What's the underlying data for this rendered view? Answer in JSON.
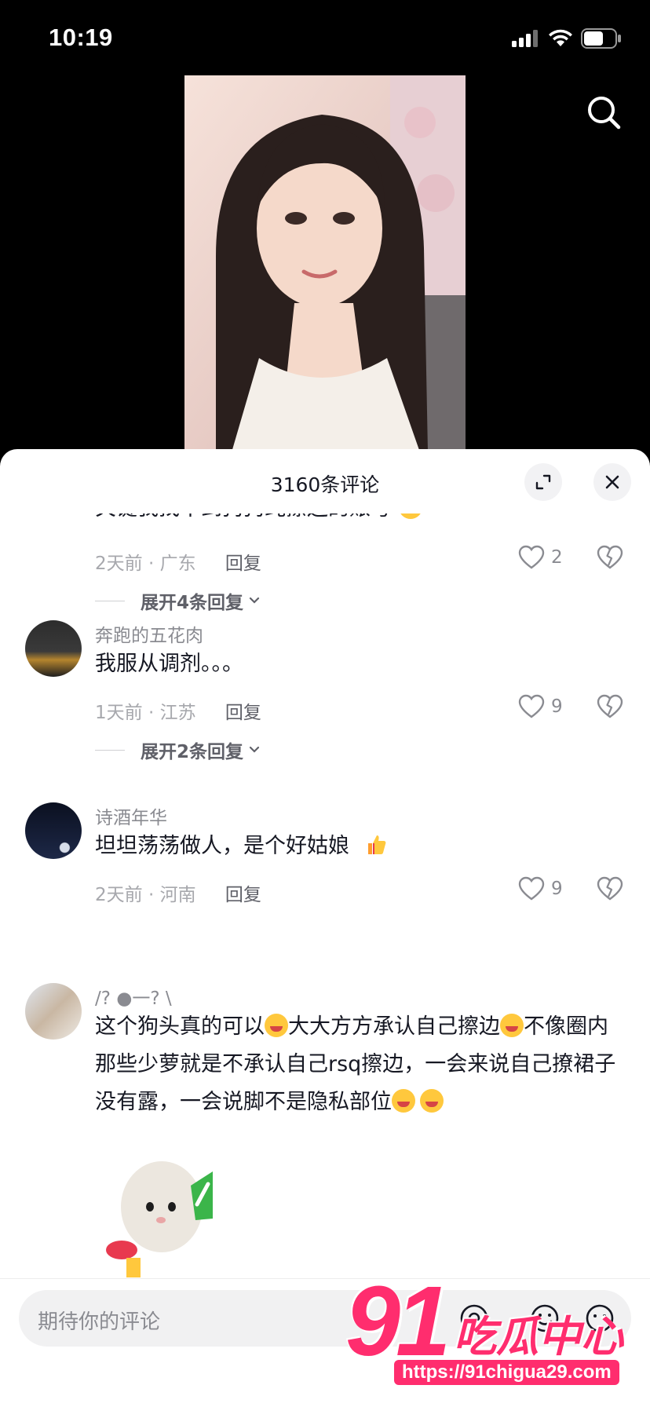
{
  "status_bar": {
    "time": "10:19"
  },
  "video": {
    "search_icon": "search-icon"
  },
  "comments_panel": {
    "title": "3160条评论",
    "expand_icon": "expand-icon",
    "close_icon": "close-icon",
    "comments": [
      {
        "username": "",
        "content": "关键我找不到狗狗纯擦边的账号",
        "time": "2天前 · 广东",
        "reply_label": "回复",
        "likes": "2",
        "expand_replies": "展开4条回复"
      },
      {
        "username": "奔跑的五花肉",
        "content": "我服从调剂。。。",
        "time": "1天前 · 江苏",
        "reply_label": "回复",
        "likes": "9",
        "expand_replies": "展开2条回复"
      },
      {
        "username": "诗酒年华",
        "content": "坦坦荡荡做人，是个好姑娘",
        "time": "2天前 · 河南",
        "reply_label": "回复",
        "likes": "9"
      },
      {
        "username": "/?  ●一?    \\",
        "content_parts": [
          "这个狗头真的可以",
          "大大方方承认自己擦边",
          "不像圈内那些少萝就是不承认自己rsq擦边，一会来说自己撩裙子没有露，一会说脚不是隐私部位"
        ]
      }
    ]
  },
  "input": {
    "placeholder": "期待你的评论"
  },
  "watermark": {
    "logo": "91",
    "brand": "吃瓜中心",
    "url": "https://91chigua29.com"
  }
}
